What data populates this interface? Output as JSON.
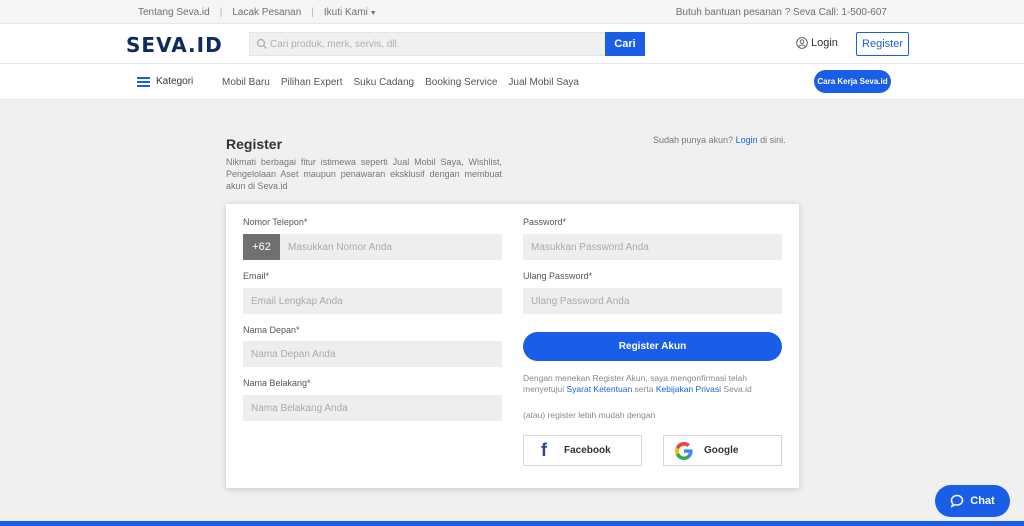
{
  "topbar": {
    "links": [
      "Tentang Seva.id",
      "Lacak Pesanan",
      "Ikuti Kami"
    ],
    "separator": "|",
    "help": "Butuh bantuan pesanan ? Seva Call: 1-500-607"
  },
  "header": {
    "logo": "SEVA.ID",
    "search_placeholder": "Cari produk, merk, servis, dll.",
    "search_button": "Cari",
    "login": "Login",
    "register": "Register"
  },
  "nav": {
    "kategori": "Kategori",
    "links": [
      "Mobil Baru",
      "Pilihan Expert",
      "Suku Cadang",
      "Booking Service",
      "Jual Mobil Saya"
    ],
    "cara_kerja": "Cara Kerja Seva.id"
  },
  "intro": {
    "title": "Register",
    "description": "Nikmati berbagai fitur istimewa seperti Jual Mobil Saya, Wishlist, Pengelolaan Aset maupun penawaran eksklusif dengan membuat akun di Seva.id",
    "already_prefix": "Sudah punya akun?",
    "already_link": "Login",
    "already_suffix": "di sini."
  },
  "form": {
    "phone_label": "Nomor Telepon*",
    "phone_prefix": "+62",
    "phone_placeholder": "Masukkan Nomor Anda",
    "email_label": "Email*",
    "email_placeholder": "Email Lengkap Anda",
    "first_name_label": "Nama Depan*",
    "first_name_placeholder": "Nama Depan Anda",
    "last_name_label": "Nama Belakang*",
    "last_name_placeholder": "Nama Belakang Anda",
    "password_label": "Password*",
    "password_placeholder": "Masukkan Password Anda",
    "confirm_label": "Ulang Password*",
    "confirm_placeholder": "Ulang Password Anda",
    "submit": "Register Akun",
    "terms_prefix": "Dengan menekan Register Akun, saya mengonfirmasi telah menyetujui",
    "terms_link": "Syarat Ketentuan",
    "terms_middle": "serta",
    "privacy_link": "Kebijakan Privasi",
    "terms_suffix": "Seva.id",
    "atau": "(atau) register lebih mudah dengan",
    "facebook": "Facebook",
    "google": "Google"
  },
  "chat": {
    "label": "Chat"
  },
  "colors": {
    "accent": "#1a5ee8",
    "logo": "#0e2a5e",
    "background": "#f0f0f0"
  },
  "icons": [
    "search-icon",
    "user-icon",
    "hamburger-icon",
    "facebook-icon",
    "google-icon",
    "chat-bubble-icon",
    "caret-down-icon"
  ]
}
